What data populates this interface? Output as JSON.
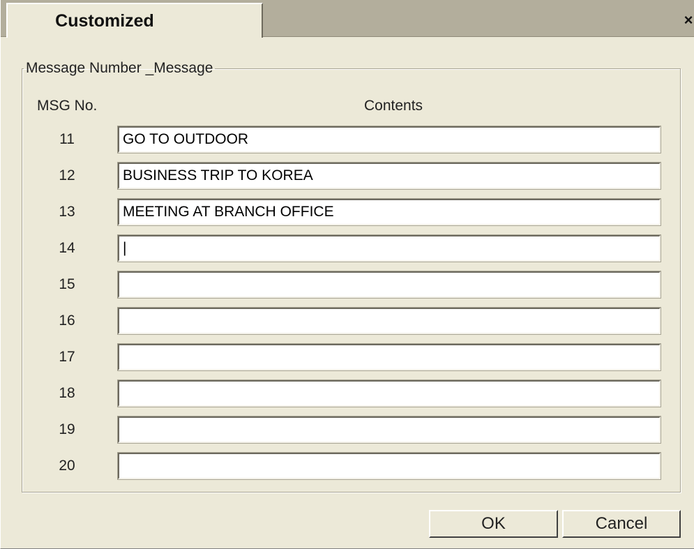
{
  "window": {
    "tab_title": "Customized",
    "close_label": "×"
  },
  "group": {
    "legend": "Message Number _Message",
    "header_msgno": "MSG No.",
    "header_contents": "Contents"
  },
  "rows": [
    {
      "number": "11",
      "value": "GO TO OUTDOOR"
    },
    {
      "number": "12",
      "value": "BUSINESS TRIP TO KOREA"
    },
    {
      "number": "13",
      "value": "MEETING AT BRANCH OFFICE"
    },
    {
      "number": "14",
      "value": "|"
    },
    {
      "number": "15",
      "value": ""
    },
    {
      "number": "16",
      "value": ""
    },
    {
      "number": "17",
      "value": ""
    },
    {
      "number": "18",
      "value": ""
    },
    {
      "number": "19",
      "value": ""
    },
    {
      "number": "20",
      "value": ""
    }
  ],
  "buttons": {
    "ok": "OK",
    "cancel": "Cancel"
  }
}
